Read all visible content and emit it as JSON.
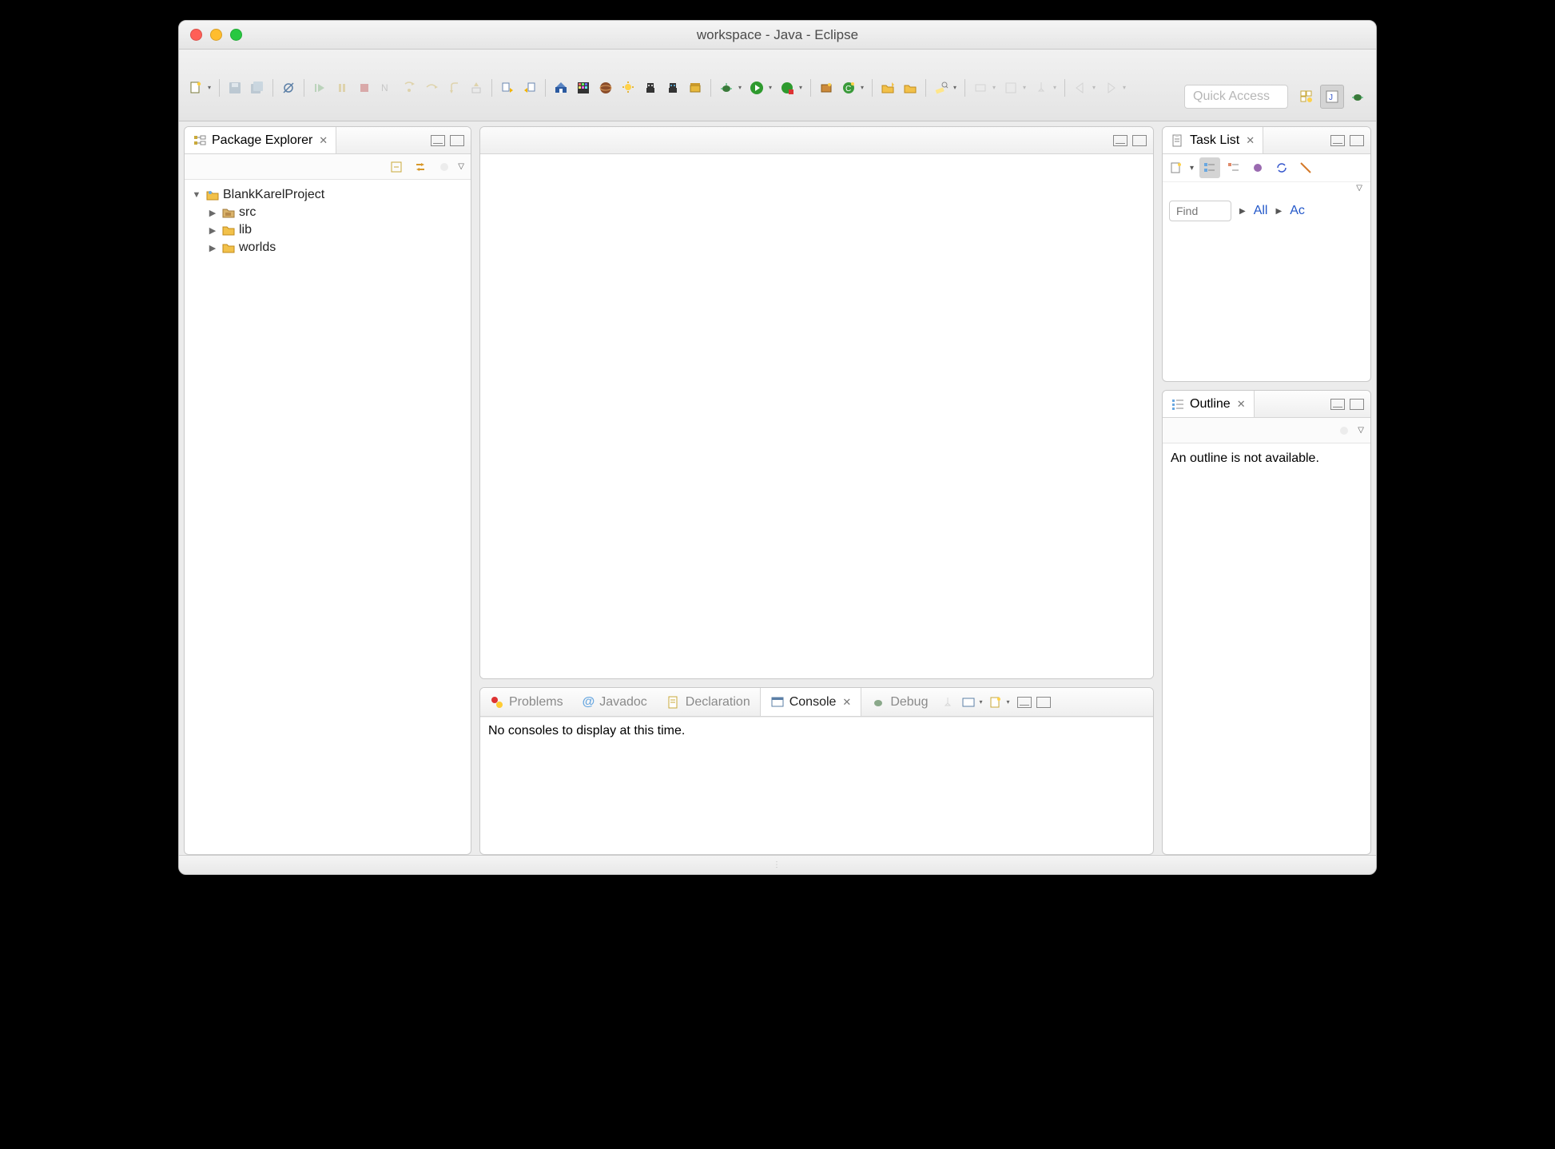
{
  "window": {
    "title": "workspace - Java - Eclipse"
  },
  "quick_access_placeholder": "Quick Access",
  "package_explorer": {
    "title": "Package Explorer",
    "project": "BlankKarelProject",
    "children": [
      "src",
      "lib",
      "worlds"
    ]
  },
  "task_list": {
    "title": "Task List",
    "find_placeholder": "Find",
    "link_all": "All",
    "link_activate": "Ac"
  },
  "outline": {
    "title": "Outline",
    "message": "An outline is not available."
  },
  "bottom": {
    "tabs": {
      "problems": "Problems",
      "javadoc": "Javadoc",
      "declaration": "Declaration",
      "console": "Console",
      "debug": "Debug"
    },
    "console_message": "No consoles to display at this time."
  }
}
